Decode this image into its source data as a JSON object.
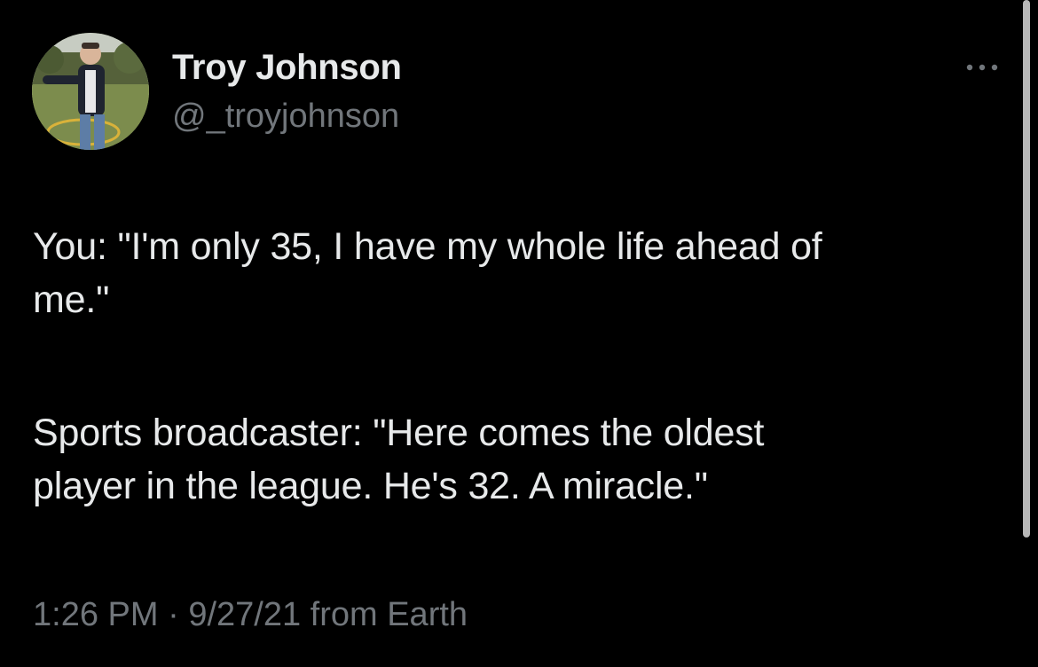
{
  "author": {
    "name": "Troy Johnson",
    "handle": "@_troyjohnson",
    "avatar_icon": "avatar-photo"
  },
  "tweet": {
    "paragraphs": [
      "You: \"I'm only 35, I have my whole life ahead of\nme.\"",
      "Sports broadcaster: \"Here comes the oldest\nplayer in the league. He's 32. A miracle.\""
    ],
    "time": "1:26 PM",
    "separator": "·",
    "date_source": "9/27/21 from Earth"
  },
  "menu": {
    "more_icon": "more-horizontal-icon"
  },
  "colors": {
    "background": "#000000",
    "text": "#e7e9ea",
    "secondary": "#71767b"
  }
}
